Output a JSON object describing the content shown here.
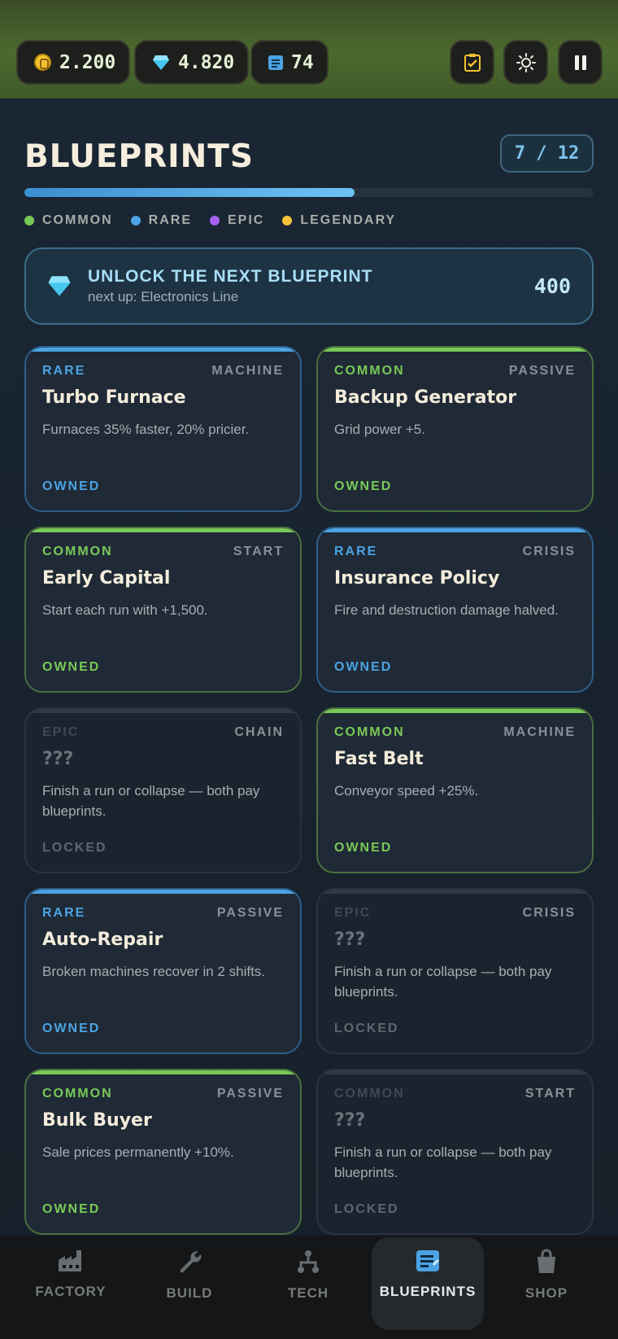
{
  "hud": {
    "coins": "2.200",
    "gems": "4.820",
    "blueprints": "74"
  },
  "header": {
    "title": "BLUEPRINTS",
    "counter": "7 / 12",
    "progress": 0.58
  },
  "legend": [
    {
      "label": "COMMON",
      "color": "#79c957"
    },
    {
      "label": "RARE",
      "color": "#4ba3e3"
    },
    {
      "label": "EPIC",
      "color": "#a560f0"
    },
    {
      "label": "LEGENDARY",
      "color": "#f3c33a"
    }
  ],
  "unlock": {
    "title": "UNLOCK THE NEXT BLUEPRINT",
    "subtitle": "next up: Electronics Line",
    "cost": "400"
  },
  "cards": [
    {
      "rarity": "RARE",
      "category": "MACHINE",
      "name": "Turbo Furnace",
      "desc": "Furnaces 35% faster, 20% pricier.",
      "status": "OWNED",
      "style": "rare"
    },
    {
      "rarity": "COMMON",
      "category": "PASSIVE",
      "name": "Backup Generator",
      "desc": "Grid power +5.",
      "status": "OWNED",
      "style": "common"
    },
    {
      "rarity": "COMMON",
      "category": "START",
      "name": "Early Capital",
      "desc": "Start each run with +1,500.",
      "status": "OWNED",
      "style": "common"
    },
    {
      "rarity": "RARE",
      "category": "CRISIS",
      "name": "Insurance Policy",
      "desc": "Fire and destruction damage halved.",
      "status": "OWNED",
      "style": "rare"
    },
    {
      "rarity": "EPIC",
      "category": "CHAIN",
      "name": "???",
      "desc": "Finish a run or collapse — both pay blueprints.",
      "status": "LOCKED",
      "style": "locked"
    },
    {
      "rarity": "COMMON",
      "category": "MACHINE",
      "name": "Fast Belt",
      "desc": "Conveyor speed +25%.",
      "status": "OWNED",
      "style": "common"
    },
    {
      "rarity": "RARE",
      "category": "PASSIVE",
      "name": "Auto-Repair",
      "desc": "Broken machines recover in 2 shifts.",
      "status": "OWNED",
      "style": "rare"
    },
    {
      "rarity": "EPIC",
      "category": "CRISIS",
      "name": "???",
      "desc": "Finish a run or collapse — both pay blueprints.",
      "status": "LOCKED",
      "style": "locked"
    },
    {
      "rarity": "COMMON",
      "category": "PASSIVE",
      "name": "Bulk Buyer",
      "desc": "Sale prices permanently +10%.",
      "status": "OWNED",
      "style": "common"
    },
    {
      "rarity": "COMMON",
      "category": "START",
      "name": "???",
      "desc": "Finish a run or collapse — both pay blueprints.",
      "status": "LOCKED",
      "style": "locked"
    }
  ],
  "nav": [
    {
      "label": "FACTORY",
      "icon": "factory-icon"
    },
    {
      "label": "BUILD",
      "icon": "wrench-icon"
    },
    {
      "label": "TECH",
      "icon": "tech-tree-icon"
    },
    {
      "label": "BLUEPRINTS",
      "icon": "blueprint-icon",
      "active": true
    },
    {
      "label": "SHOP",
      "icon": "shopping-bag-icon"
    }
  ]
}
